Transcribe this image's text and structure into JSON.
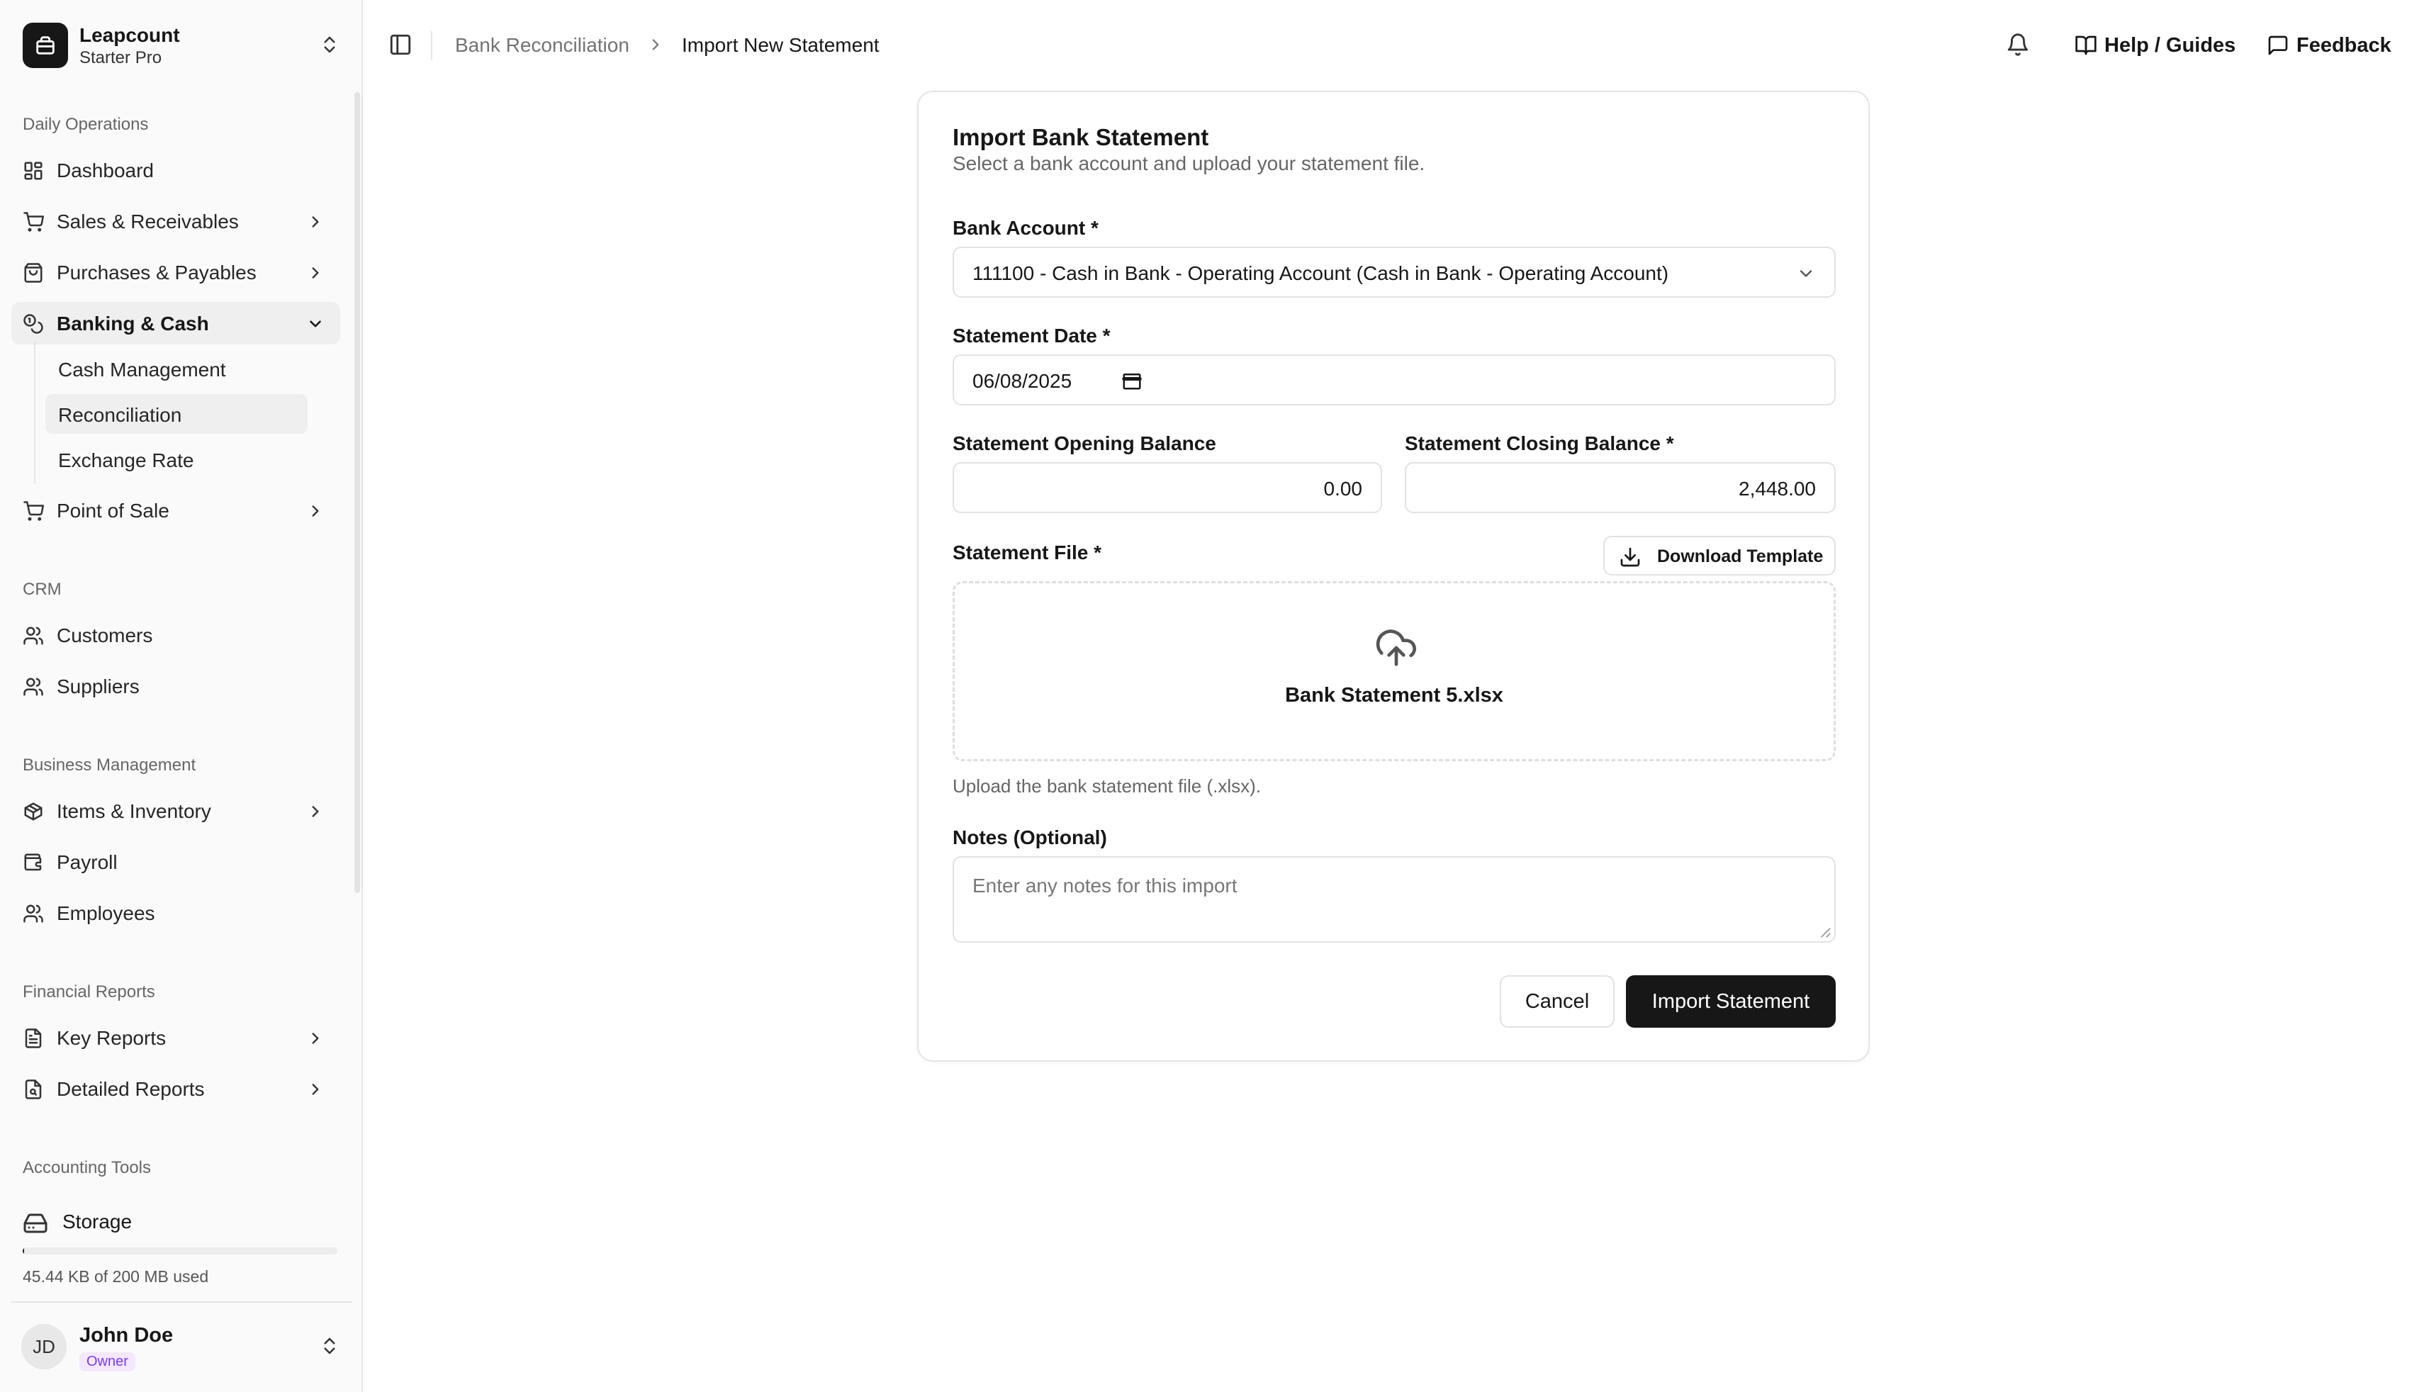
{
  "brand": {
    "name": "Leapcount",
    "plan": "Starter Pro"
  },
  "sidebar": {
    "sections": {
      "daily": "Daily Operations",
      "crm": "CRM",
      "business": "Business Management",
      "reports": "Financial Reports",
      "tools": "Accounting Tools"
    },
    "items": {
      "dashboard": "Dashboard",
      "sales": "Sales & Receivables",
      "purchases": "Purchases & Payables",
      "banking": "Banking & Cash",
      "pos": "Point of Sale",
      "customers": "Customers",
      "suppliers": "Suppliers",
      "items_inventory": "Items & Inventory",
      "payroll": "Payroll",
      "employees": "Employees",
      "key_reports": "Key Reports",
      "detailed_reports": "Detailed Reports"
    },
    "banking_sub": {
      "cash_management": "Cash Management",
      "reconciliation": "Reconciliation",
      "exchange_rate": "Exchange Rate"
    },
    "active_item": "Reconciliation"
  },
  "storage": {
    "label": "Storage",
    "used_text": "45.44 KB of 200 MB used",
    "used_fraction": 0.0002
  },
  "user": {
    "initials": "JD",
    "name": "John Doe",
    "role": "Owner"
  },
  "header": {
    "breadcrumb_parent": "Bank Reconciliation",
    "breadcrumb_current": "Import New Statement",
    "help_label": "Help / Guides",
    "feedback_label": "Feedback"
  },
  "form": {
    "title": "Import Bank Statement",
    "subtitle": "Select a bank account and upload your statement file.",
    "bank_account_label": "Bank Account *",
    "bank_account_value": "111100 - Cash in Bank - Operating Account (Cash in Bank - Operating Account)",
    "statement_date_label": "Statement Date *",
    "statement_date_value": "06/08/2025",
    "opening_balance_label": "Statement Opening Balance",
    "opening_balance_value": "0.00",
    "closing_balance_label": "Statement Closing Balance *",
    "closing_balance_value": "2,448.00",
    "statement_file_label": "Statement File *",
    "download_template_label": "Download Template",
    "uploaded_file": "Bank Statement 5.xlsx",
    "file_hint": "Upload the bank statement file (.xlsx).",
    "notes_label": "Notes (Optional)",
    "notes_placeholder": "Enter any notes for this import",
    "cancel_label": "Cancel",
    "submit_label": "Import Statement"
  },
  "colors": {
    "primary": "#171717",
    "border": "#e5e5e5",
    "sidebar_bg": "#fafafa",
    "role_badge": "#7c3aed"
  }
}
